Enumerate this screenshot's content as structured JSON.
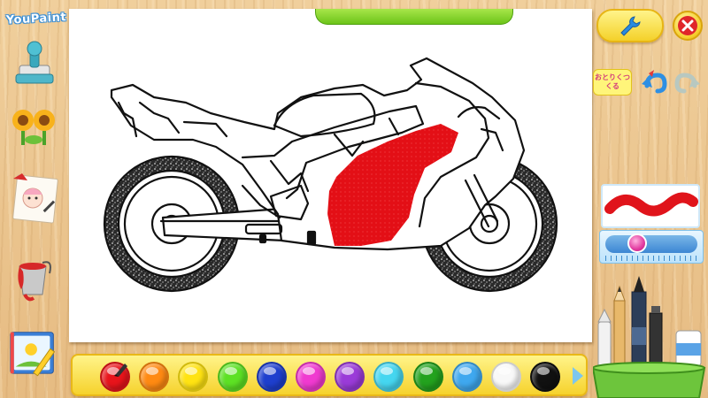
{
  "app": {
    "logo_text": "YouPaint"
  },
  "top_right": {
    "otorikun_label": "おとりくつくる"
  },
  "palette": {
    "colors": [
      {
        "name": "red",
        "hex": "#e8141b",
        "selected": true
      },
      {
        "name": "orange",
        "hex": "#ff8a12"
      },
      {
        "name": "yellow",
        "hex": "#ffe312"
      },
      {
        "name": "green",
        "hex": "#5de124"
      },
      {
        "name": "blue",
        "hex": "#1e3fce"
      },
      {
        "name": "magenta",
        "hex": "#f03ad0"
      },
      {
        "name": "purple",
        "hex": "#9a3bd8"
      },
      {
        "name": "cyan",
        "hex": "#45d6f0"
      },
      {
        "name": "dark-green",
        "hex": "#23a21e"
      },
      {
        "name": "sky-blue",
        "hex": "#3fa8ef"
      },
      {
        "name": "white",
        "hex": "#f8f8f8"
      },
      {
        "name": "black",
        "hex": "#111111"
      }
    ]
  },
  "brush": {
    "preview_color": "#e0141b",
    "size_fraction": 0.3
  },
  "left_tools": [
    {
      "icon": "stamp-icon"
    },
    {
      "icon": "flower-icon"
    },
    {
      "icon": "sticker-gallery-icon"
    },
    {
      "icon": "paint-bucket-icon"
    },
    {
      "icon": "crayon-book-icon"
    }
  ],
  "colors": {
    "canvas_fill": "#e30f16"
  }
}
